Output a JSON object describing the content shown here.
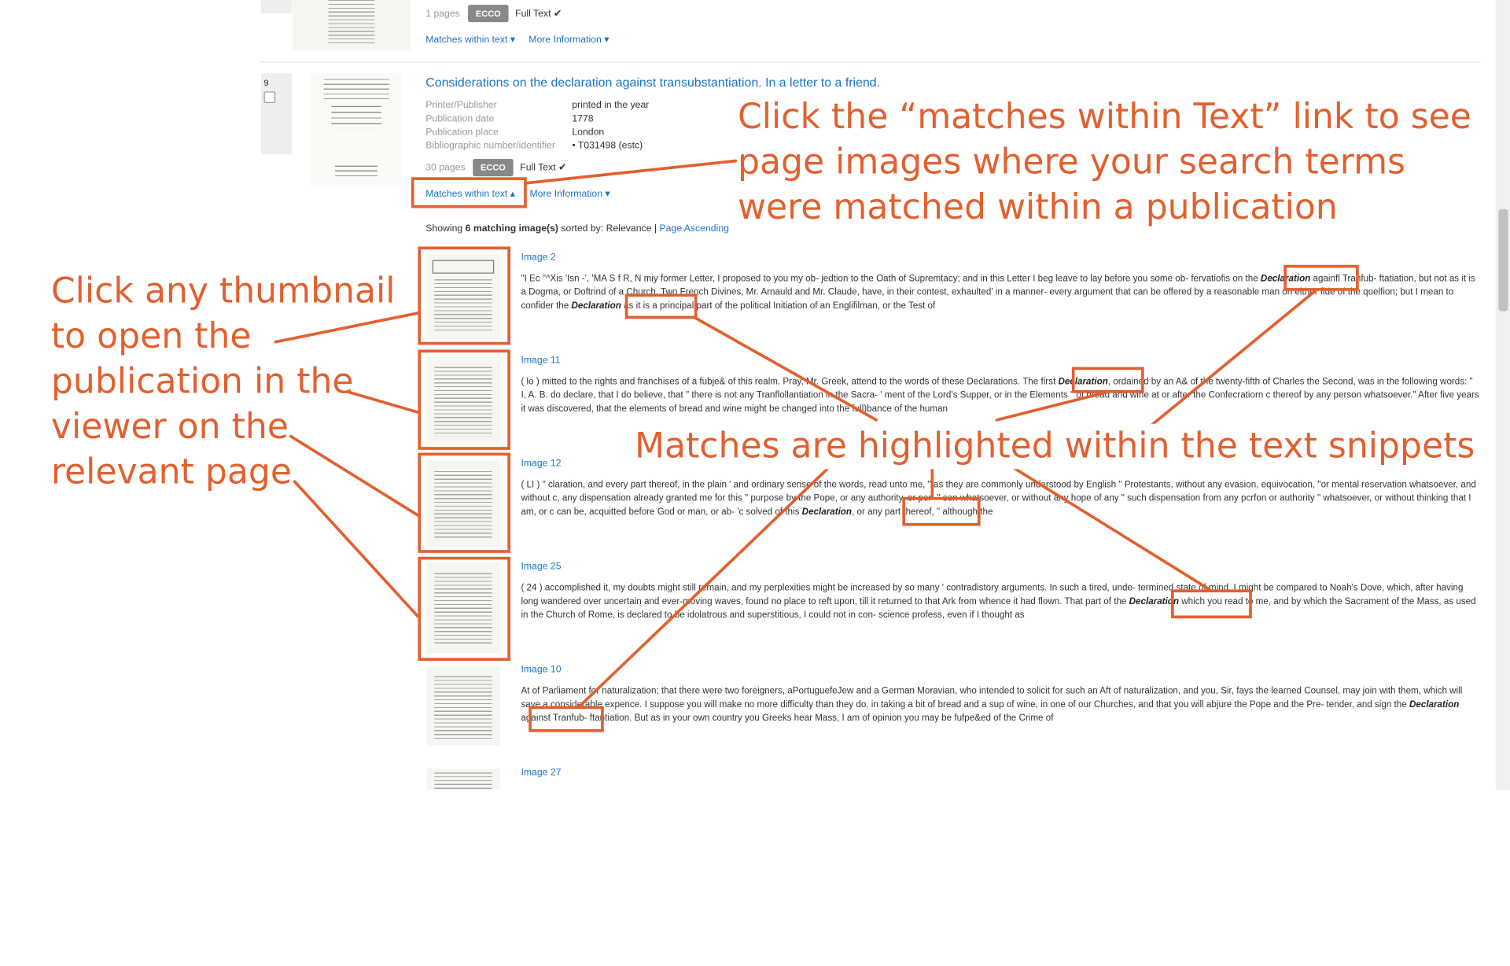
{
  "result_prev": {
    "pages": "1 pages",
    "source_badge": "ECCO",
    "full_text": "Full Text ✔",
    "matches_link": "Matches within text ▾",
    "more_info_link": "More Information ▾"
  },
  "result": {
    "index": "9",
    "title": "Considerations on the declaration against transubstantiation. In a letter to a friend.",
    "meta": [
      {
        "label": "Printer/Publisher",
        "value": "printed in the year"
      },
      {
        "label": "Publication date",
        "value": "1778"
      },
      {
        "label": "Publication place",
        "value": "London"
      },
      {
        "label": "Bibliographic number/identifier",
        "value": "•  T031498 (estc)"
      }
    ],
    "pages": "30 pages",
    "source_badge": "ECCO",
    "full_text": "Full Text ✔",
    "matches_link": "Matches within text ▴",
    "more_info_link": "More Information ▾",
    "showing_prefix": "Showing ",
    "showing_count": "6 matching image(s)",
    "showing_suffix": " sorted by: Relevance | ",
    "sort_link": "Page Ascending"
  },
  "matches": [
    {
      "label": "Image 2",
      "before": "\"I Ec \"^Xis 'Isn -', 'MA S f R, N miy former Letter, I proposed to you my ob- jedtion to the Oath of Supremtacy; and in this Letter I beg leave to lay before you some ob- fervatiofis on the ",
      "term": "Declaration",
      "after": " againfl Tranfub- ftatiation, but not as it is a Dogma, or Doftrind of a Church. Two French Divines, Mr. Arnauld and Mr. Claude, have, in their contest, exhaulted' in a manner- every argument that can be offered by a reasonable man on either fide of the quelfion; but I mean to confider the ",
      "term2": "Declaration",
      "after2": " as it is a principal part of the political Initiation of an Englifilman, or the Test of"
    },
    {
      "label": "Image 11",
      "before": "( lo ) mitted to the rights and franchises of a fubje& of this realm. Pray, Mr. Greek, attend to the words of these Declarations. The first ",
      "term": "Declaration",
      "after": ", ordained by an A& of the twenty-fifth of Charles the Second, was in the following words: \" I, A. B. do declare, that I do believe, that \" there is not any Tranflollantiation in the Sacra- ' ment of the Lord's Supper, or in the Elements \" of bread and wine at or after the Confecratiorn c thereof by any person whatsoever.\" After five years it was discovered, that the elements of bread and wine might be changed into the full)bance of the human"
    },
    {
      "label": "Image 12",
      "before": "( LI ) \" claration, and every part thereof, in the plain ' and ordinary sense of the words, read unto me, \" as they are commonly understood by English \" Protestants, without any evasion, equivocation, \"or mental reservation whatsoever, and without c, any dispensation already granted me for this \" purpose by the Pope, or any authority, or per- \" son whatsoever, or without any hope of any \" such dispensation from any pcrfon or authority \" whatsoever, or without thinking that I am, or c can be, acquitted before God or man, or ab- 'c solved of this ",
      "term": "Declaration",
      "after": ", or any part thereof, \" although the"
    },
    {
      "label": "Image 25",
      "before": "( 24 ) accomplished it, my doubts might still remain, and my perplexities might be increased by so many ' contradistory arguments. In such a tired, unde- termined state of mind, I might be compared to Noah's Dove, which, after having long wandered over uncertain and ever-moving waves, found no place to reft upon, till it returned to that Ark from whence it had flown. That part of the ",
      "term": "Declaration",
      "after": " which you read to me, and by which the Sacrament of the Mass, as used in the Church of Rome, is declared to be idolatrous and superstitious, I could not in con- science profess, even if I thought as"
    },
    {
      "label": "Image 10",
      "before": "At of Parliament for naturalization; that there were two foreigners, aPortuguefeJew and a German Moravian, who intended to solicit for such an Aft of naturalization, and you, Sir, fays the learned Counsel, may join with them, which will save a considerable expence. I suppose you will make no more difficulty than they do, in taking a bit of bread and a sup of wine, in one of our Churches, and that you will abjure the Pope and the Pre- tender, and sign the ",
      "term": "Declaration",
      "after": " against Tranfub- ftantiation. But as in your own country you Greeks hear Mass, I am of opinion you may be fufpe&ed of the Crime of"
    },
    {
      "label": "Image 27",
      "before": "",
      "term": "",
      "after": ""
    }
  ],
  "annotations": {
    "matches_link_callout": [
      "Click the “matches within Text” link to see",
      "page images where your search terms",
      "were matched within a publication"
    ],
    "thumbnail_callout": [
      "Click any thumbnail",
      "to open the",
      "publication in the",
      "viewer on the",
      "relevant page"
    ],
    "highlight_callout": "Matches are highlighted within the text snippets"
  },
  "colors": {
    "accent": "#e2602f",
    "link": "#1a73c8",
    "badge": "#888888"
  }
}
